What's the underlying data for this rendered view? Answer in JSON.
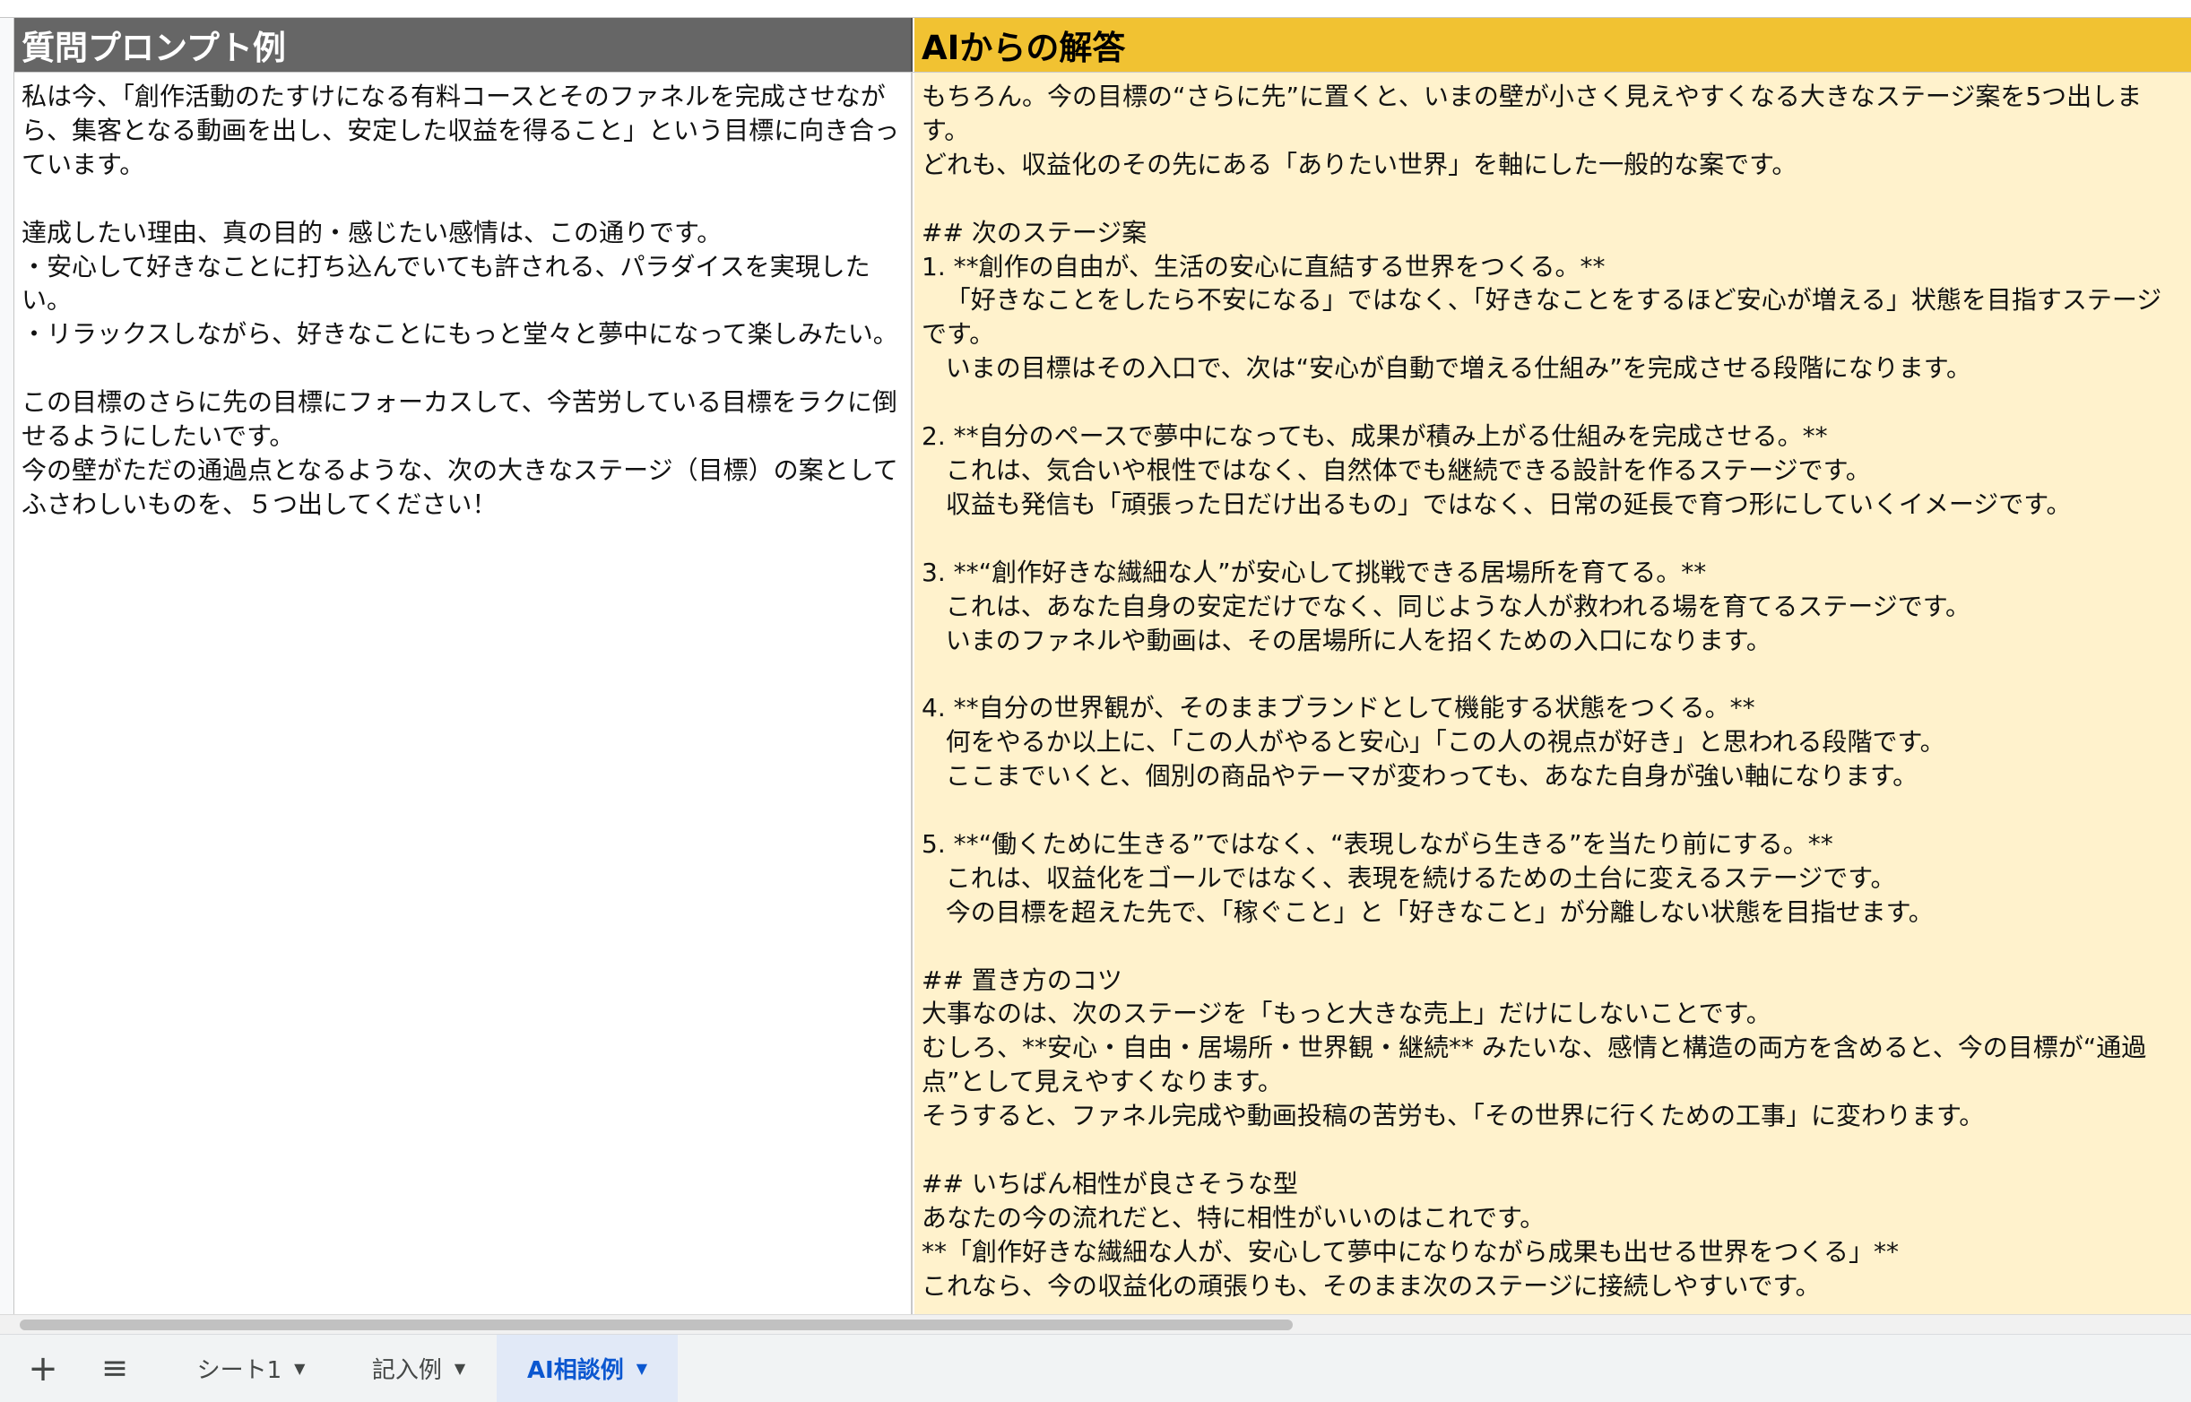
{
  "sheet": {
    "header_question": "質問プロンプト例",
    "header_answer": "AIからの解答",
    "question": "私は今、「創作活動のたすけになる有料コースとそのファネルを完成させながら、集客となる動画を出し、安定した収益を得ること」という目標に向き合っています。\n\n達成したい理由、真の目的・感じたい感情は、この通りです。\n・安心して好きなことに打ち込んでいても許される、パラダイスを実現したい。\n・リラックスしながら、好きなことにもっと堂々と夢中になって楽しみたい。\n\nこの目標のさらに先の目標にフォーカスして、今苦労している目標をラクに倒せるようにしたいです。\n今の壁がただの通過点となるような、次の大きなステージ（目標）の案としてふさわしいものを、５つ出してください！",
    "answer": "もちろん。今の目標の“さらに先”に置くと、いまの壁が小さく見えやすくなる大きなステージ案を5つ出します。\nどれも、収益化のその先にある「ありたい世界」を軸にした一般的な案です。\n\n## 次のステージ案\n1. **創作の自由が、生活の安心に直結する世界をつくる。**\n   「好きなことをしたら不安になる」ではなく、「好きなことをするほど安心が増える」状態を目指すステージです。\n   いまの目標はその入口で、次は“安心が自動で増える仕組み”を完成させる段階になります。\n\n2. **自分のペースで夢中になっても、成果が積み上がる仕組みを完成させる。**\n   これは、気合いや根性ではなく、自然体でも継続できる設計を作るステージです。\n   収益も発信も「頑張った日だけ出るもの」ではなく、日常の延長で育つ形にしていくイメージです。\n\n3. **“創作好きな繊細な人”が安心して挑戦できる居場所を育てる。**\n   これは、あなた自身の安定だけでなく、同じような人が救われる場を育てるステージです。\n   いまのファネルや動画は、その居場所に人を招くための入口になります。\n\n4. **自分の世界観が、そのままブランドとして機能する状態をつくる。**\n   何をやるか以上に、「この人がやると安心」「この人の視点が好き」と思われる段階です。\n   ここまでいくと、個別の商品やテーマが変わっても、あなた自身が強い軸になります。\n\n5. **“働くために生きる”ではなく、“表現しながら生きる”を当たり前にする。**\n   これは、収益化をゴールではなく、表現を続けるための土台に変えるステージです。\n   今の目標を超えた先で、「稼ぐこと」と「好きなこと」が分離しない状態を目指せます。\n\n## 置き方のコツ\n大事なのは、次のステージを「もっと大きな売上」だけにしないことです。\nむしろ、**安心・自由・居場所・世界観・継続** みたいな、感情と構造の両方を含めると、今の目標が“通過点”として見えやすくなります。\nそうすると、ファネル完成や動画投稿の苦労も、「その世界に行くための工事」に変わります。\n\n## いちばん相性が良さそうな型\nあなたの今の流れだと、特に相性がいいのはこれです。\n**「創作好きな繊細な人が、安心して夢中になりながら成果も出せる世界をつくる」**\nこれなら、今の収益化の頑張りも、そのまま次のステージに接続しやすいです。"
  },
  "tabs": [
    {
      "label": "シート1",
      "active": false
    },
    {
      "label": "記入例",
      "active": false
    },
    {
      "label": "AI相談例",
      "active": true
    }
  ],
  "icons": {
    "add": "plus-icon",
    "all_sheets": "menu-icon",
    "tab_menu": "caret-down-icon"
  },
  "colors": {
    "question_header_bg": "#666666",
    "answer_header_bg": "#f1c232",
    "answer_cell_bg": "#fff2cc",
    "active_tab_bg": "#e1e9f7",
    "active_tab_text": "#0b57d0"
  }
}
